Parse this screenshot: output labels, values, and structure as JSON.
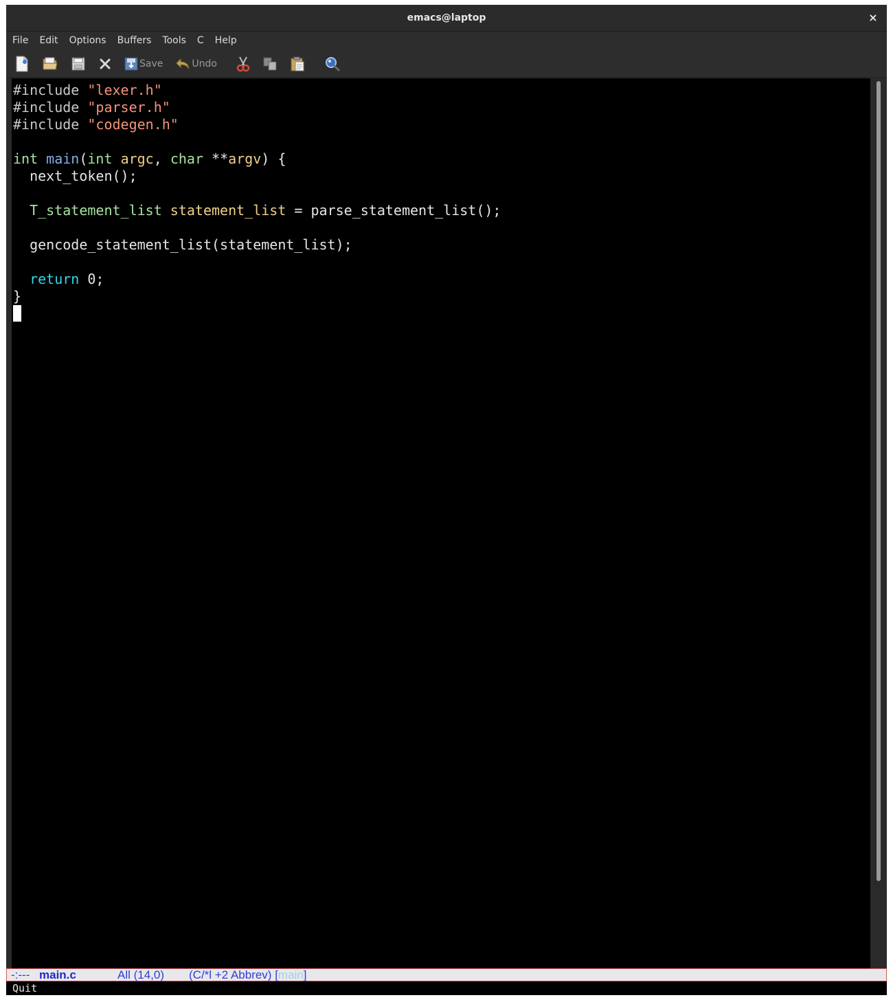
{
  "window": {
    "title": "emacs@laptop",
    "close_glyph": "×"
  },
  "menu": [
    "File",
    "Edit",
    "Options",
    "Buffers",
    "Tools",
    "C",
    "Help"
  ],
  "toolbar": {
    "save_label": "Save",
    "undo_label": "Undo",
    "icons": [
      "new-file-icon",
      "open-folder-icon",
      "save-disk-icon",
      "close-icon",
      "save-icon",
      "undo-icon",
      "cut-icon",
      "copy-icon",
      "paste-icon",
      "search-icon"
    ]
  },
  "code": {
    "line1": {
      "directive": "#include",
      "arg": "\"lexer.h\""
    },
    "line2": {
      "directive": "#include",
      "arg": "\"parser.h\""
    },
    "line3": {
      "directive": "#include",
      "arg": "\"codegen.h\""
    },
    "line5": {
      "t1": "int",
      "fn": "main",
      "p1": "(",
      "t2": "int",
      "v1": "argc",
      "p2": ", ",
      "t3": "char",
      "p3": " **",
      "v2": "argv",
      "p4": ") {"
    },
    "line6": "  next_token();",
    "line8": {
      "indent": "  ",
      "type": "T_statement_list",
      "sp": " ",
      "var": "statement_list",
      "rest": " = parse_statement_list();"
    },
    "line10": "  gencode_statement_list(statement_list);",
    "line12": {
      "indent": "  ",
      "kw": "return",
      "rest": " 0;"
    },
    "line13": "}"
  },
  "modeline": {
    "status": "-:---",
    "buffer": "main.c",
    "position": "All (14,0)",
    "mode_open": "(C/*l +2 Abbrev) [",
    "func": "main",
    "mode_close": "]"
  },
  "minibuffer": "Quit",
  "colors": {
    "background": "#000000",
    "string": "#f4947a",
    "type": "#a6e3a1",
    "function": "#7fb0e6",
    "variable": "#f0d089",
    "keyword": "#35d7e8",
    "modeline_text": "#2c3fd6"
  }
}
